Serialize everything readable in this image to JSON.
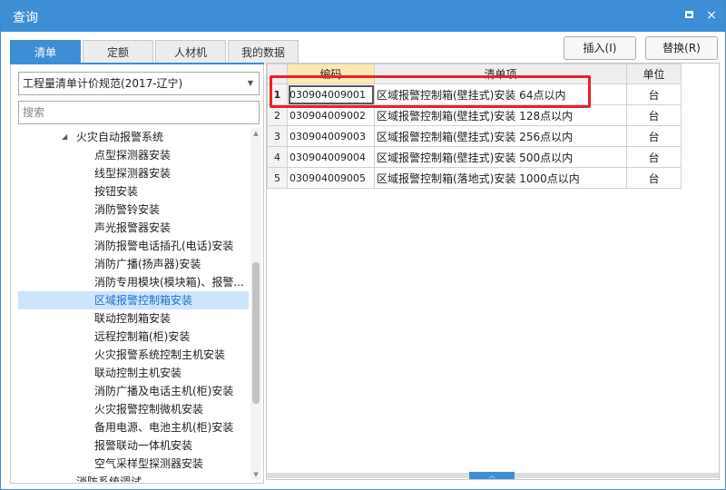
{
  "window": {
    "title": "查询",
    "maximize_icon": "maximize-icon",
    "close_glyph": "×"
  },
  "tabs": [
    {
      "label": "清单",
      "active": true
    },
    {
      "label": "定额",
      "active": false
    },
    {
      "label": "人材机",
      "active": false
    },
    {
      "label": "我的数据",
      "active": false
    }
  ],
  "left_panel": {
    "spec_select": "工程量清单计价规范(2017-辽宁)",
    "search_placeholder": "搜索",
    "tree": {
      "parent": "火灾自动报警系统",
      "items": [
        "点型探测器安装",
        "线型探测器安装",
        "按钮安装",
        "消防警铃安装",
        "声光报警器安装",
        "消防报警电话插孔(电话)安装",
        "消防广播(扬声器)安装",
        "消防专用模块(模块箱)、报警...",
        "区域报警控制箱安装",
        "联动控制箱安装",
        "远程控制箱(柜)安装",
        "火灾报警系统控制主机安装",
        "联动控制主机安装",
        "消防广播及电话主机(柜)安装",
        "火灾报警控制微机安装",
        "备用电源、电池主机(柜)安装",
        "报警联动一体机安装",
        "空气采样型探测器安装"
      ],
      "partial_last": "消防系统调试",
      "selected_index": 8
    }
  },
  "toolbar": {
    "insert_label": "插入(I)",
    "replace_label": "替换(R)"
  },
  "grid": {
    "headers": {
      "code": "编码",
      "item": "清单项",
      "unit": "单位"
    },
    "rows": [
      {
        "n": "1",
        "code": "030904009001",
        "item": "区域报警控制箱(壁挂式)安装  64点以内",
        "unit": "台"
      },
      {
        "n": "2",
        "code": "030904009002",
        "item": "区域报警控制箱(壁挂式)安装  128点以内",
        "unit": "台"
      },
      {
        "n": "3",
        "code": "030904009003",
        "item": "区域报警控制箱(壁挂式)安装  256点以内",
        "unit": "台"
      },
      {
        "n": "4",
        "code": "030904009004",
        "item": "区域报警控制箱(壁挂式)安装  500点以内",
        "unit": "台"
      },
      {
        "n": "5",
        "code": "030904009005",
        "item": "区域报警控制箱(落地式)安装  1000点以内",
        "unit": "台"
      }
    ],
    "selected_row": 0
  },
  "colors": {
    "accent": "#3e8ed6",
    "highlight": "#e8232a",
    "selected_tree_bg": "#cde4fb"
  }
}
